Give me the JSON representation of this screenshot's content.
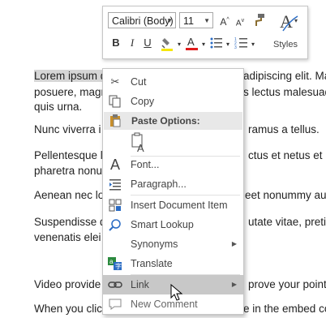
{
  "document": {
    "paragraphs": [
      {
        "selected": "Lorem ipsum d",
        "rest": "",
        "tail": "adipiscing elit. Ma"
      },
      {
        "text": "posuere, magr",
        "tail": "s lectus malesuad"
      },
      {
        "text": "quis urna.",
        "tail": ""
      },
      {
        "text": "Nunc viverra i",
        "tail": "ramus a tellus."
      },
      {
        "text": "Pellentesque l",
        "tail": "ctus et netus et m"
      },
      {
        "text": "pharetra nonu",
        "tail": ""
      },
      {
        "text": "Aenean nec lo",
        "tail": "eet nonummy aug"
      },
      {
        "text": "Suspendisse d",
        "tail": "utate vitae, pretiu"
      },
      {
        "text": "venenatis elei",
        "tail": ""
      },
      {
        "text": "Video provide",
        "tail": "prove your point"
      },
      {
        "text": "When you clic",
        "tail": "e in the embed co"
      }
    ]
  },
  "mini_toolbar": {
    "font_name": "Calibri (Body)",
    "font_size": "11",
    "styles_label": "Styles",
    "highlight_color": "#f5e60a",
    "font_color": "#e01b1b"
  },
  "context_menu": {
    "items": {
      "cut": "Cut",
      "copy": "Copy",
      "paste_header": "Paste Options:",
      "font": "Font...",
      "paragraph": "Paragraph...",
      "insert_doc_item": "Insert Document Item",
      "smart_lookup": "Smart Lookup",
      "synonyms": "Synonyms",
      "translate": "Translate",
      "link": "Link",
      "new_comment": "New Comment"
    }
  }
}
